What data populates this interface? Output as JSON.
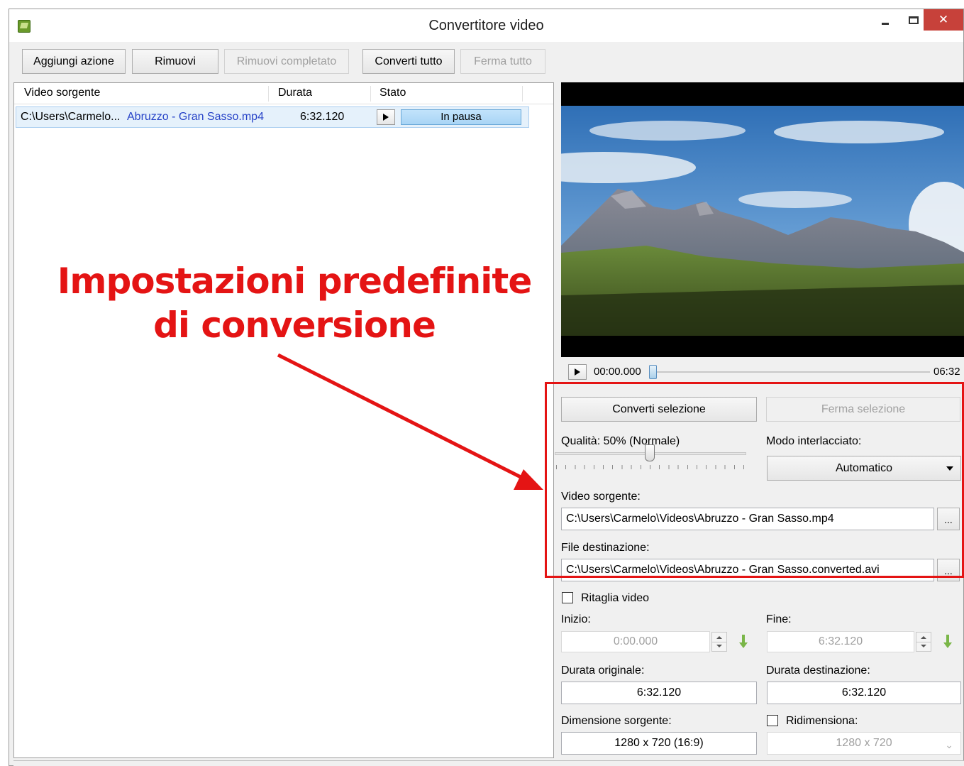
{
  "window": {
    "title": "Convertitore video"
  },
  "toolbar": {
    "add": "Aggiungi azione",
    "remove": "Rimuovi",
    "remove_done": "Rimuovi completato",
    "convert_all": "Converti tutto",
    "stop_all": "Ferma tutto"
  },
  "list": {
    "headers": {
      "source": "Video sorgente",
      "duration": "Durata",
      "status": "Stato"
    },
    "rows": [
      {
        "path_prefix": "C:\\Users\\Carmelo...",
        "path_file": "Abruzzo - Gran Sasso.mp4",
        "duration": "6:32.120",
        "status": "In pausa"
      }
    ]
  },
  "annotation": {
    "line1": "Impostazioni predefinite",
    "line2": "di conversione",
    "color": "#e41414"
  },
  "player": {
    "current": "00:00.000",
    "end": "06:32"
  },
  "settings": {
    "convert_selection": "Converti selezione",
    "stop_selection": "Ferma selezione",
    "quality_label": "Qualità: 50% (Normale)",
    "quality_value": 0.5,
    "interlace_label": "Modo interlacciato:",
    "interlace_value": "Automatico",
    "source_label": "Video sorgente:",
    "source_value": "C:\\Users\\Carmelo\\Videos\\Abruzzo - Gran Sasso.mp4",
    "dest_label": "File destinazione:",
    "dest_value": "C:\\Users\\Carmelo\\Videos\\Abruzzo - Gran Sasso.converted.avi",
    "browse": "...",
    "crop_label": "Ritaglia video",
    "start_label": "Inizio:",
    "start_value": "0:00.000",
    "end_label": "Fine:",
    "end_value": "6:32.120",
    "orig_dur_label": "Durata originale:",
    "orig_dur_value": "6:32.120",
    "dest_dur_label": "Durata destinazione:",
    "dest_dur_value": "6:32.120",
    "src_dim_label": "Dimensione sorgente:",
    "src_dim_value": "1280 x 720 (16:9)",
    "resize_label": "Ridimensiona:",
    "resize_value": "1280 x 720"
  }
}
